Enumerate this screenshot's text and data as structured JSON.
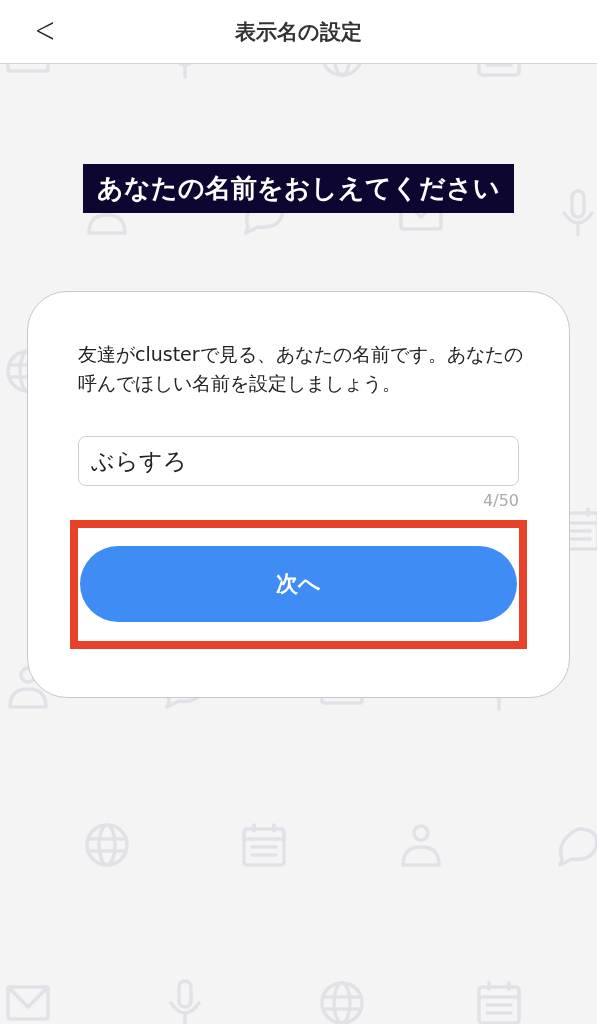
{
  "header": {
    "back": "<",
    "title": "表示名の設定"
  },
  "heading": "あなたの名前をおしえてください",
  "card": {
    "description": "友達がclusterで見る、あなたの名前です。あなたの呼んでほしい名前を設定しましょう。",
    "name_field": {
      "value": "ぶらすろ"
    },
    "counter": "4/50",
    "next_button": {
      "label": "次へ",
      "highlighted": true
    }
  }
}
